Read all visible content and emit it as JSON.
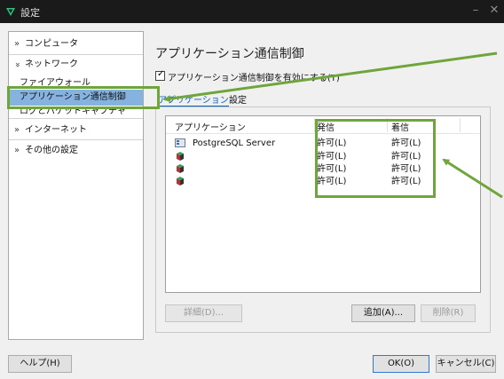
{
  "window": {
    "title": "設定",
    "minimize": "–",
    "close": "✕"
  },
  "sidebar": {
    "items": [
      {
        "label": "コンピュータ",
        "chevron": "»"
      },
      {
        "label": "ネットワーク",
        "chevron": "»"
      },
      {
        "label": "ファイアウォール"
      },
      {
        "label": "アプリケーション通信制御"
      },
      {
        "label": "ログとパケットキャプチャ"
      },
      {
        "label": "インターネット",
        "chevron": "»"
      },
      {
        "label": "その他の設定",
        "chevron": "»"
      }
    ]
  },
  "main": {
    "title": "アプリケーション通信制御",
    "enable_checkbox": {
      "label": "アプリケーション通信制御を有効にする(T)",
      "checked": true
    },
    "tabs": [
      {
        "label": "アプリケーション"
      },
      {
        "label": "設定"
      }
    ],
    "table": {
      "columns": [
        "アプリケーション",
        "発信",
        "着信"
      ],
      "rows": [
        {
          "app": "PostgreSQL Server",
          "outbound": "許可(L)",
          "inbound": "許可(L)"
        },
        {
          "app": "",
          "outbound": "許可(L)",
          "inbound": "許可(L)"
        },
        {
          "app": "",
          "outbound": "許可(L)",
          "inbound": "許可(L)"
        },
        {
          "app": "",
          "outbound": "許可(L)",
          "inbound": "許可(L)"
        }
      ]
    },
    "buttons": {
      "details": "詳細(D)...",
      "add": "追加(A)...",
      "delete": "削除(R)"
    }
  },
  "footer": {
    "help": "ヘルプ(H)",
    "ok": "OK(O)",
    "cancel": "キャンセル(C)"
  },
  "colors": {
    "annotation": "#6fa53a",
    "selection": "#86b2e0",
    "link": "#0a62b5",
    "titlebar": "#1a1a1a"
  }
}
